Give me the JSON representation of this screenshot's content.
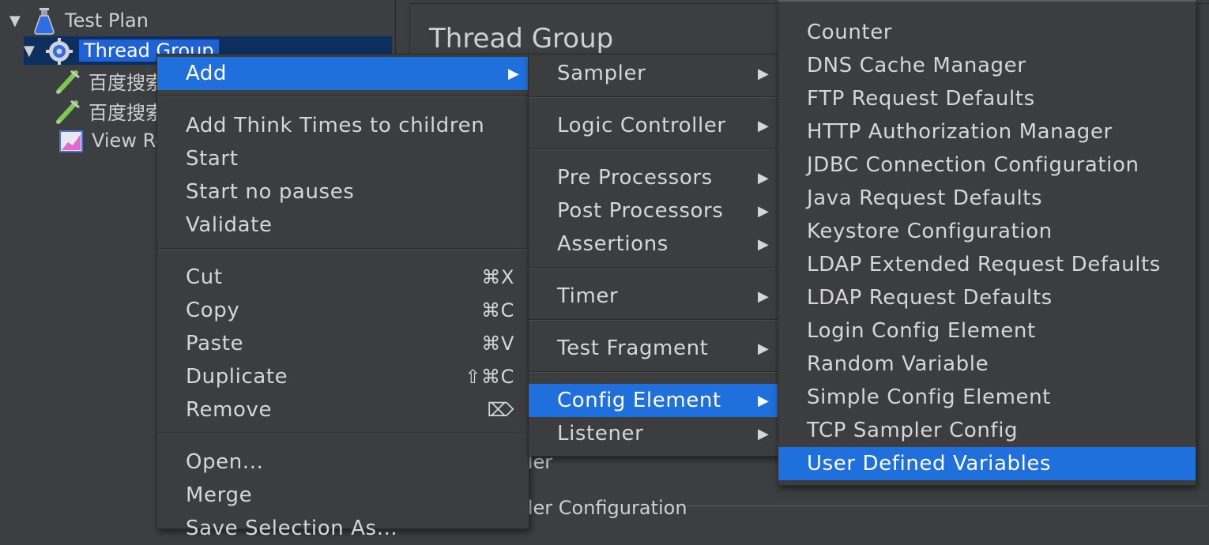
{
  "tree": {
    "items": [
      {
        "label": "Test Plan",
        "icon": "flask-icon"
      },
      {
        "label": "Thread Group",
        "icon": "gear-icon"
      },
      {
        "label": "百度搜索",
        "icon": "pipette-icon"
      },
      {
        "label": "百度搜索",
        "icon": "pipette-icon"
      },
      {
        "label": "View Results",
        "icon": "chart-icon"
      }
    ]
  },
  "right_panel": {
    "title": "Thread Group",
    "scheduler_label": "Scheduler",
    "scheduler_config_label": "Scheduler Configuration"
  },
  "context_menu": {
    "items": [
      {
        "label": "Add",
        "arrow": "▶"
      },
      {
        "label": "Add Think Times to children"
      },
      {
        "label": "Start"
      },
      {
        "label": "Start no pauses"
      },
      {
        "label": "Validate"
      },
      {
        "label": "Cut",
        "shortcut": "⌘X"
      },
      {
        "label": "Copy",
        "shortcut": "⌘C"
      },
      {
        "label": "Paste",
        "shortcut": "⌘V"
      },
      {
        "label": "Duplicate",
        "shortcut": "⇧⌘C"
      },
      {
        "label": "Remove",
        "shortcut": "⌦"
      },
      {
        "label": "Open..."
      },
      {
        "label": "Merge"
      },
      {
        "label": "Save Selection As..."
      }
    ]
  },
  "add_submenu": {
    "items": [
      {
        "label": "Sampler",
        "arrow": "▶"
      },
      {
        "label": "Logic Controller",
        "arrow": "▶"
      },
      {
        "label": "Pre Processors",
        "arrow": "▶"
      },
      {
        "label": "Post Processors",
        "arrow": "▶"
      },
      {
        "label": "Assertions",
        "arrow": "▶"
      },
      {
        "label": "Timer",
        "arrow": "▶"
      },
      {
        "label": "Test Fragment",
        "arrow": "▶"
      },
      {
        "label": "Config Element",
        "arrow": "▶"
      },
      {
        "label": "Listener",
        "arrow": "▶"
      }
    ]
  },
  "config_submenu": {
    "items": [
      {
        "label": "Counter"
      },
      {
        "label": "DNS Cache Manager"
      },
      {
        "label": "FTP Request Defaults"
      },
      {
        "label": "HTTP Authorization Manager"
      },
      {
        "label": "JDBC Connection Configuration"
      },
      {
        "label": "Java Request Defaults"
      },
      {
        "label": "Keystore Configuration"
      },
      {
        "label": "LDAP Extended Request Defaults"
      },
      {
        "label": "LDAP Request Defaults"
      },
      {
        "label": "Login Config Element"
      },
      {
        "label": "Random Variable"
      },
      {
        "label": "Simple Config Element"
      },
      {
        "label": "TCP Sampler Config"
      },
      {
        "label": "User Defined Variables"
      }
    ]
  },
  "colors": {
    "selection": "#1f6fdc",
    "background": "#3c3f41",
    "menu_background": "#3b3d3f"
  }
}
